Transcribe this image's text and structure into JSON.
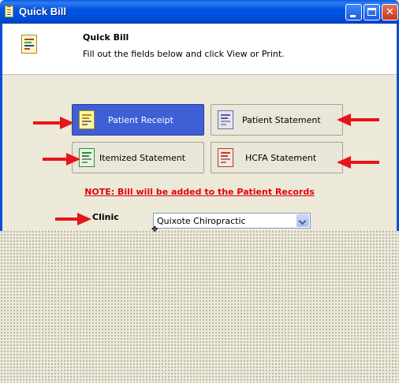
{
  "window": {
    "title": "Quick Bill",
    "controls": {
      "minimize": "minimize-icon",
      "maximize": "maximize-icon",
      "close": "close-icon"
    }
  },
  "header": {
    "title": "Quick Bill",
    "subtitle": "Fill out the fields below and click View or Print.",
    "icon": "bill-document-icon"
  },
  "buttons": {
    "patient_receipt": "Patient Receipt",
    "patient_statement": "Patient Statement",
    "itemized_statement": "Itemized Statement",
    "hcfa_statement": "HCFA Statement"
  },
  "note": "NOTE: Bill will be added to the Patient Records",
  "clinic": {
    "label": "Clinic",
    "selected": "Quixote Chiropractic"
  },
  "colors": {
    "accent": "#3f5fd6",
    "note": "#e4000e",
    "annotation_arrow": "#e8141c"
  }
}
